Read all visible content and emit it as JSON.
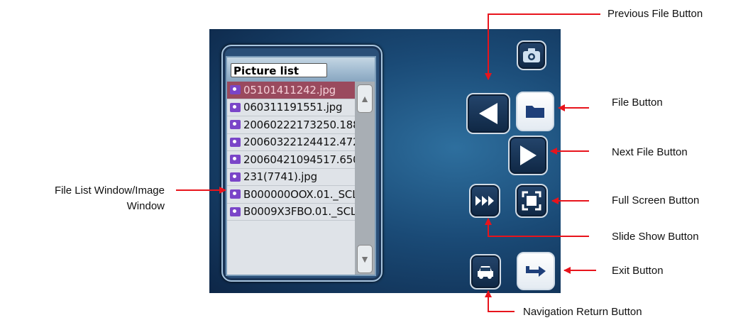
{
  "callouts": {
    "previous_file": "Previous File Button",
    "file": "File Button",
    "next_file": "Next File Button",
    "full_screen": "Full Screen Button",
    "slide_show": "Slide Show Button",
    "exit": "Exit Button",
    "navigation_return": "Navigation Return Button",
    "file_list_line1": "File List Window/Image",
    "file_list_line2": "Window"
  },
  "picture_list": {
    "header": "Picture list",
    "selected_index": 0,
    "files": [
      "05101411242.jpg",
      "060311191551.jpg",
      "20060222173250.188...",
      "20060322124412.472...",
      "20060421094517.650...",
      "231(7741).jpg",
      "B000000OOX.01._SCL...",
      "B0009X3FBO.01._SCL..."
    ]
  },
  "icons": {
    "camera": "camera-icon",
    "previous": "triangle-left-icon",
    "folder": "folder-icon",
    "next": "triangle-right-icon",
    "slide_show": "fast-forward-icon",
    "full_screen": "fullscreen-icon",
    "navigation": "car-icon",
    "exit": "exit-arrow-icon"
  },
  "colors": {
    "annotation_arrow": "#e8141c",
    "screen_bg": "#1a4a76",
    "selected_row": "#9a4a5e",
    "file_icon": "#7a45c8"
  }
}
